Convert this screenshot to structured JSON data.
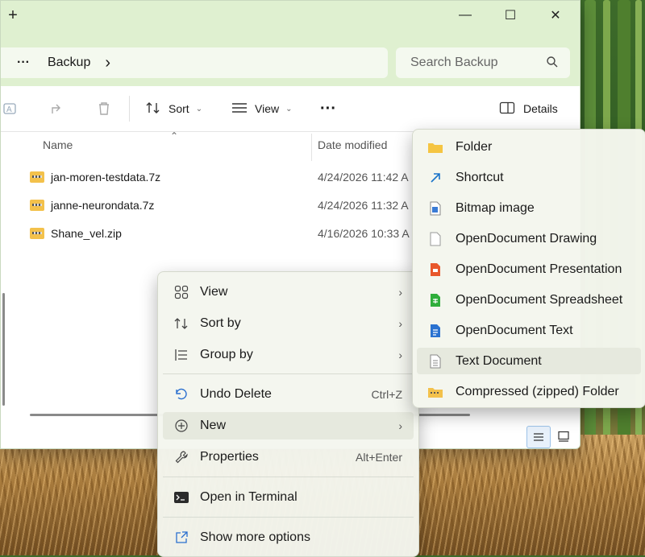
{
  "window": {
    "new_tab_symbol": "+",
    "minimize": "—",
    "maximize": "☐",
    "close": "✕"
  },
  "address": {
    "more": "···",
    "folder": "Backup",
    "chevron": "›",
    "search_placeholder": "Search Backup"
  },
  "toolbar": {
    "sort": "Sort",
    "view": "View",
    "more": "···",
    "details": "Details"
  },
  "columns": {
    "name": "Name",
    "date_modified": "Date modified"
  },
  "files": [
    {
      "name": "jan-moren-testdata.7z",
      "date": "4/24/2026 11:42 A"
    },
    {
      "name": "janne-neurondata.7z",
      "date": "4/24/2026 11:32 A"
    },
    {
      "name": "Shane_vel.zip",
      "date": "4/16/2026 10:33 A"
    }
  ],
  "context_menu": {
    "view": "View",
    "sort_by": "Sort by",
    "group_by": "Group by",
    "undo_delete": "Undo Delete",
    "undo_shortcut": "Ctrl+Z",
    "new": "New",
    "properties": "Properties",
    "properties_shortcut": "Alt+Enter",
    "open_terminal": "Open in Terminal",
    "show_more": "Show more options",
    "submenu_arrow": "›"
  },
  "new_submenu": [
    {
      "label": "Folder",
      "icon": "folder-icon",
      "color": "#f5c542"
    },
    {
      "label": "Shortcut",
      "icon": "shortcut-icon",
      "color": "#1a73c9"
    },
    {
      "label": "Bitmap image",
      "icon": "bitmap-icon",
      "color": "#3a7bd5"
    },
    {
      "label": "OpenDocument Drawing",
      "icon": "drawing-icon",
      "color": "#9a9a9a"
    },
    {
      "label": "OpenDocument Presentation",
      "icon": "presentation-icon",
      "color": "#e8572b"
    },
    {
      "label": "OpenDocument Spreadsheet",
      "icon": "spreadsheet-icon",
      "color": "#2fae3b"
    },
    {
      "label": "OpenDocument Text",
      "icon": "text-doc-icon",
      "color": "#2a72d0"
    },
    {
      "label": "Text Document",
      "icon": "txt-icon",
      "color": "#8a8a8a"
    },
    {
      "label": "Compressed (zipped) Folder",
      "icon": "zip-folder-icon",
      "color": "#f3c14b"
    }
  ]
}
